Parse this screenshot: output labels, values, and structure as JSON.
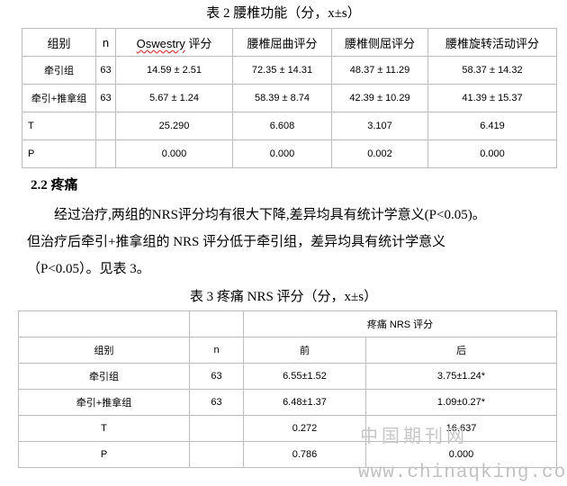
{
  "table2": {
    "caption": "表 2 腰椎功能（分，x±s）",
    "headers": [
      "组别",
      "n",
      "Oswestry",
      " 评分",
      "腰椎屈曲评分",
      "腰椎侧屈评分",
      "腰椎旋转活动评分"
    ],
    "rows": [
      [
        "牵引组",
        "63",
        "14.59 ± 2.51",
        "72.35 ± 14.31",
        "48.37 ± 11.29",
        "58.37 ± 14.32"
      ],
      [
        "牵引+推拿组",
        "63",
        "5.67 ± 1.24",
        "58.39 ± 8.74",
        "42.39 ± 10.29",
        "41.39 ± 15.37"
      ],
      [
        "T",
        "",
        "25.290",
        "6.608",
        "3.107",
        "6.419"
      ],
      [
        "P",
        "",
        "0.000",
        "0.000",
        "0.002",
        "0.000"
      ]
    ]
  },
  "section": {
    "heading": "2.2 疼痛",
    "para1": "经过治疗,两组的NRS评分均有很大下降,差异均具有统计学意义(P<0.05)。",
    "para2": "但治疗后牵引+推拿组的 NRS 评分低于牵引组，差异均具有统计学意义",
    "para3": "（P<0.05）。见表 3。"
  },
  "table3": {
    "caption": "表 3 疼痛 NRS 评分（分，x±s）",
    "group_header": "疼痛 NRS 评分",
    "headers": [
      "组别",
      "n",
      "前",
      "后"
    ],
    "rows": [
      [
        "牵引组",
        "63",
        "6.55±1.52",
        "3.75±1.24*"
      ],
      [
        "牵引+推拿组",
        "63",
        "6.48±1.37",
        "1.09±0.27*"
      ],
      [
        "T",
        "",
        "0.272",
        "16.637"
      ],
      [
        "P",
        "",
        "0.786",
        "0.000"
      ]
    ]
  },
  "watermark": {
    "line1": "中国期刊网",
    "line2": "www.chinaqking.com"
  }
}
